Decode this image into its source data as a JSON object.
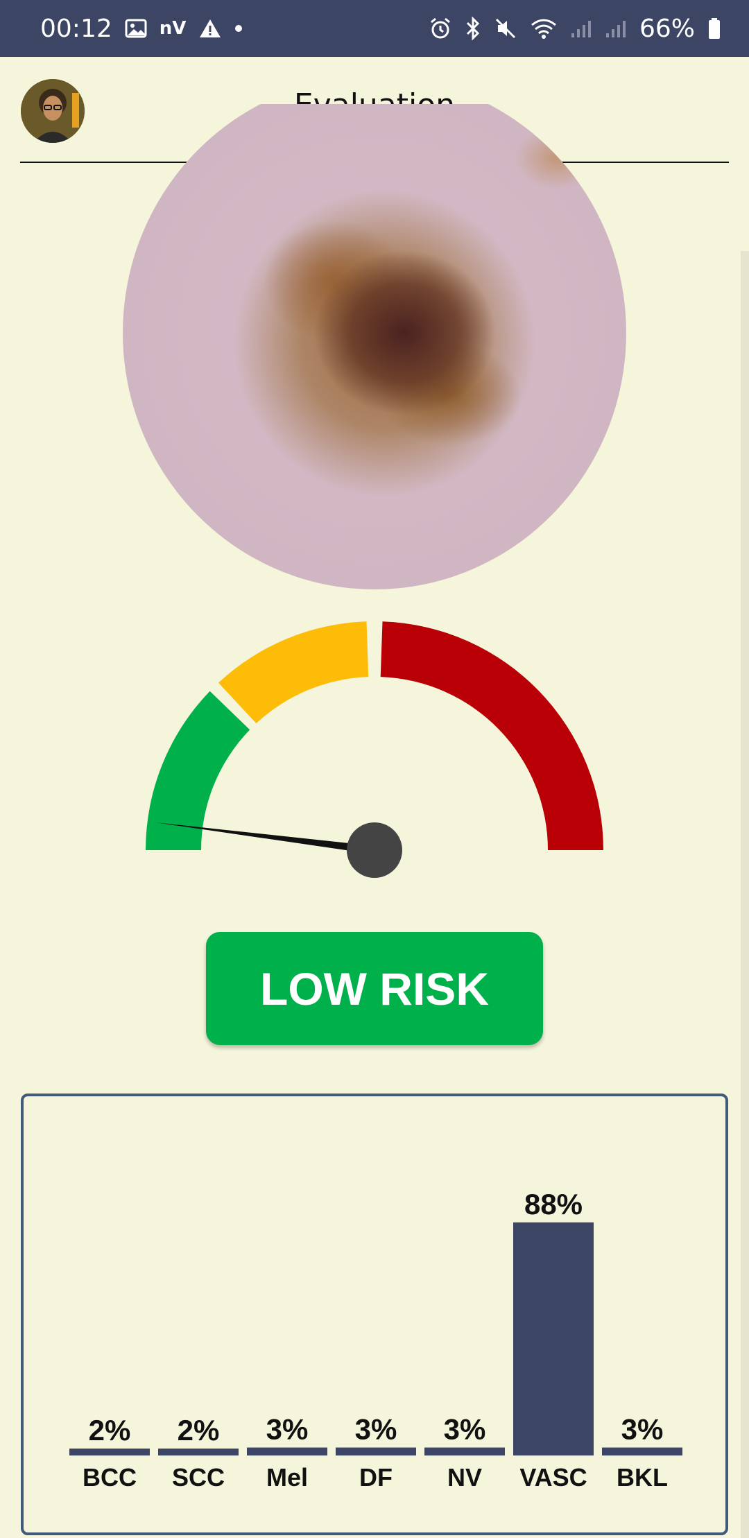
{
  "status_bar": {
    "time": "00:12",
    "carrier_text": "nV",
    "battery": "66%",
    "icons_left": [
      "image-icon",
      "nv-text",
      "warning-icon",
      "dot-icon"
    ],
    "icons_right": [
      "alarm-icon",
      "bluetooth-icon",
      "mute-icon",
      "wifi-icon",
      "signal-icon",
      "signal-icon",
      "battery-icon"
    ]
  },
  "header": {
    "title": "Evaluation"
  },
  "gauge": {
    "value": 0.04,
    "segments": [
      {
        "name": "low",
        "color": "#00b14b"
      },
      {
        "name": "medium",
        "color": "#fdbc08"
      },
      {
        "name": "high",
        "color": "#b80006"
      }
    ],
    "needle_color": "#111111",
    "hub_color": "#444444"
  },
  "risk": {
    "label": "LOW RISK",
    "color": "#00b14b"
  },
  "chart_data": {
    "type": "bar",
    "categories": [
      "BCC",
      "SCC",
      "Mel",
      "DF",
      "NV",
      "VASC",
      "BKL"
    ],
    "values": [
      2,
      2,
      3,
      3,
      3,
      88,
      3
    ],
    "value_labels": [
      "2%",
      "2%",
      "3%",
      "3%",
      "3%",
      "88%",
      "3%"
    ],
    "ylim": [
      0,
      100
    ],
    "bar_color": "#3d4565",
    "title": "",
    "xlabel": "",
    "ylabel": ""
  }
}
